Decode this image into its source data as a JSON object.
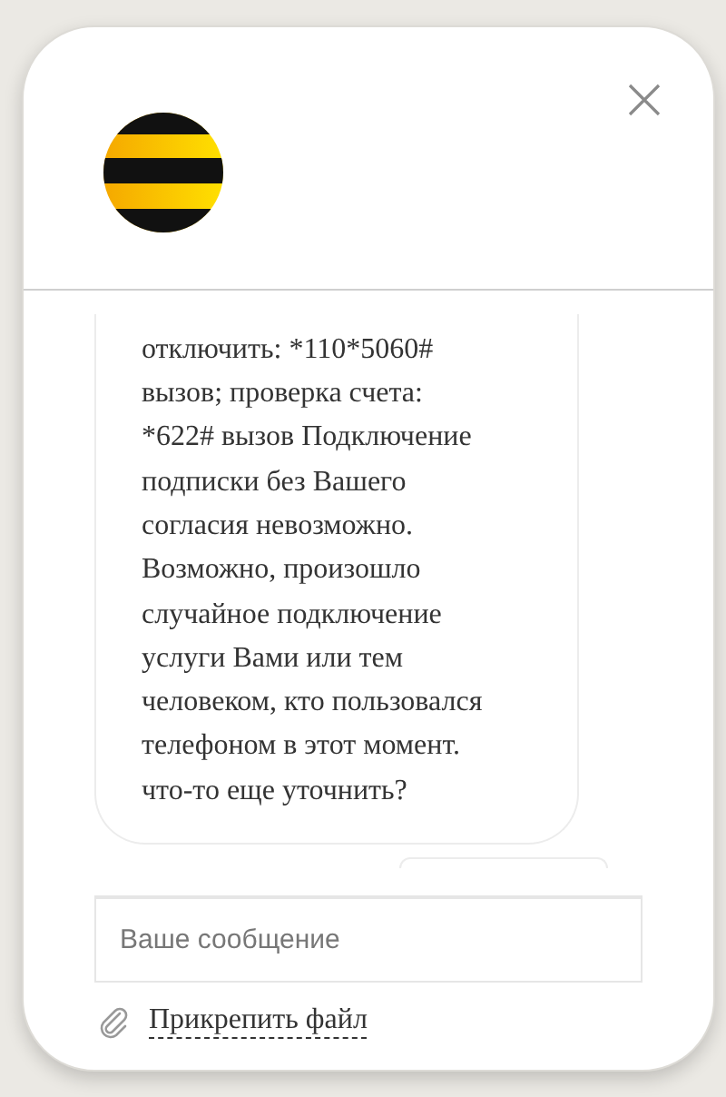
{
  "message": {
    "lines": [
      "отключить: *110*5060#",
      "вызов; проверка счета:",
      "*622# вызов Подключение",
      "подписки без Вашего",
      "согласия невозможно.",
      "Возможно, произошло",
      "случайное подключение",
      "услуги Вами или тем",
      "человеком, кто пользовался",
      "телефоном в этот момент.",
      "что-то еще уточнить?"
    ]
  },
  "input": {
    "placeholder": "Ваше сообщение"
  },
  "attach": {
    "label": "Прикрепить файл"
  }
}
